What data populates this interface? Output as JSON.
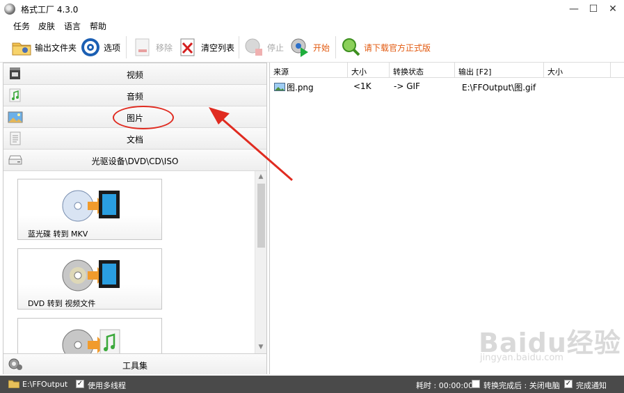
{
  "window": {
    "title": "格式工厂 4.3.0",
    "controls": [
      "—",
      "☐",
      "✕"
    ]
  },
  "menu": [
    "任务",
    "皮肤",
    "语言",
    "帮助"
  ],
  "toolbar": {
    "output_folder": "输出文件夹",
    "options": "选项",
    "remove": "移除",
    "clear_list": "清空列表",
    "stop": "停止",
    "start": "开始",
    "download": "请下载官方正式版"
  },
  "categories": [
    "视频",
    "音频",
    "图片",
    "文档",
    "光驱设备\\DVD\\CD\\ISO"
  ],
  "functions": [
    "蓝光碟 转到 MKV",
    "DVD 转到 视频文件",
    ""
  ],
  "tools_label": "工具集",
  "table": {
    "headers": [
      "来源",
      "大小",
      "转换状态",
      "输出 [F2]",
      "大小"
    ],
    "rows": [
      {
        "source": "图.png",
        "size": "<1K",
        "status": "-> GIF",
        "output": "E:\\FFOutput\\图.gif",
        "out_size": ""
      }
    ]
  },
  "status": {
    "folder": "E:\\FFOutput",
    "multithread_label": "使用多线程",
    "multithread_checked": true,
    "elapsed_label": "耗时 : 00:00:00",
    "after_done_label": "转换完成后 : 关闭电脑",
    "after_done_checked": false,
    "notify_label": "完成通知",
    "notify_checked": true
  },
  "watermark": {
    "brand": "Baidu经验",
    "url": "jingyan.baidu.com"
  },
  "colors": {
    "accent_orange": "#e25a10",
    "annotation_red": "#e02b20",
    "statusbar": "#4a4a4a"
  }
}
